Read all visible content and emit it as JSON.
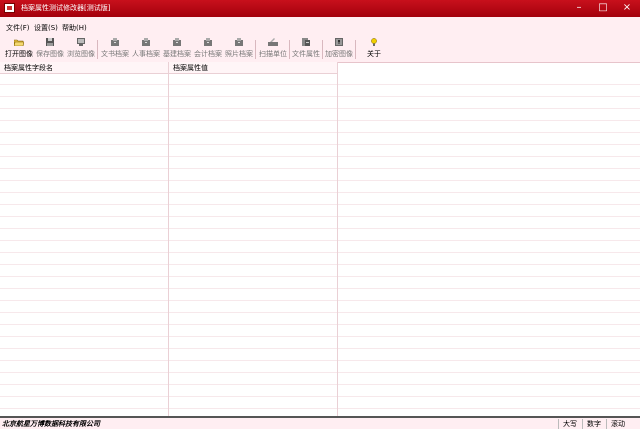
{
  "window": {
    "title": "档案属性测试修改器[测试版]",
    "minimize": "–",
    "maximize": "□",
    "close": "×"
  },
  "menu": [
    {
      "label": "文件(F)"
    },
    {
      "label": "设置(S)"
    },
    {
      "label": "帮助(H)"
    }
  ],
  "toolbar": {
    "open": {
      "label": "打开图像",
      "icon": "folder-open-icon"
    },
    "save": {
      "label": "保存图像",
      "icon": "save-icon"
    },
    "browse": {
      "label": "浏览图像",
      "icon": "browse-icon"
    },
    "text_archive": {
      "label": "文书档案",
      "icon": "archive-icon"
    },
    "personnel_archive": {
      "label": "人事档案",
      "icon": "archive-icon"
    },
    "construction_archive": {
      "label": "基建档案",
      "icon": "archive-icon"
    },
    "accounting_archive": {
      "label": "会计档案",
      "icon": "archive-icon"
    },
    "photo_archive": {
      "label": "照片档案",
      "icon": "archive-icon"
    },
    "scan_unit": {
      "label": "扫描单位",
      "icon": "scanner-icon"
    },
    "file_properties": {
      "label": "文件属性",
      "icon": "properties-icon"
    },
    "encrypt_image": {
      "label": "加密图像",
      "icon": "encrypt-icon"
    },
    "about": {
      "label": "关于",
      "icon": "lightbulb-icon"
    }
  },
  "grid": {
    "columns": [
      {
        "label": "档案属性字段名"
      },
      {
        "label": "档案属性值"
      }
    ]
  },
  "status": {
    "company": "北京航星万博数据科技有限公司",
    "caps": "大写",
    "num": "数字",
    "scroll": "滚动"
  }
}
